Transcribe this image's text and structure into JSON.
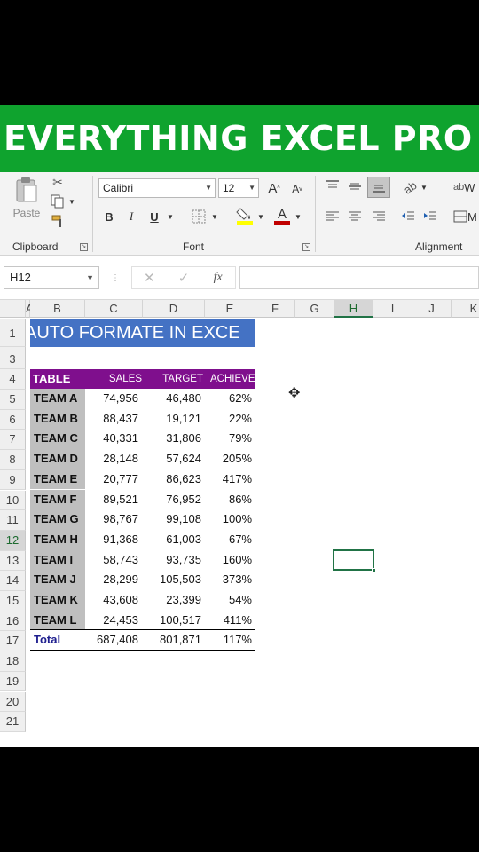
{
  "banner": {
    "text": "EVERYTHING EXCEL PRO"
  },
  "ribbon": {
    "clipboard": {
      "paste_label": "Paste",
      "group_label": "Clipboard"
    },
    "font": {
      "font_name": "Calibri",
      "font_size": "12",
      "grow_label": "A",
      "shrink_label": "A",
      "bold": "B",
      "italic": "I",
      "underline": "U",
      "font_color_label": "A",
      "group_label": "Font"
    },
    "alignment": {
      "group_label": "Alignment",
      "wrap_label": "W",
      "merge_label": "M"
    },
    "colors": {
      "highlight": "#ffff00",
      "font_color": "#c00000"
    }
  },
  "formula_bar": {
    "name_box": "H12",
    "cancel": "✕",
    "enter": "✓",
    "fx": "fx",
    "formula": ""
  },
  "columns": [
    "A",
    "B",
    "C",
    "D",
    "E",
    "F",
    "G",
    "H",
    "I",
    "J",
    "K"
  ],
  "selected_column": "H",
  "rows": [
    "1",
    "2",
    "3",
    "4",
    "5",
    "6",
    "7",
    "8",
    "9",
    "10",
    "11",
    "12",
    "13",
    "14",
    "15",
    "16",
    "17",
    "18",
    "19",
    "20",
    "21"
  ],
  "selected_row": "12",
  "sheet": {
    "title": "AUTO FORMATE IN EXCE",
    "headers": [
      "TABLE",
      "SALES",
      "TARGET",
      "ACHIEVE"
    ],
    "teams": [
      {
        "team": "TEAM A",
        "sales": "74,956",
        "target": "46,480",
        "achieve": "62%"
      },
      {
        "team": "TEAM B",
        "sales": "88,437",
        "target": "19,121",
        "achieve": "22%"
      },
      {
        "team": "TEAM C",
        "sales": "40,331",
        "target": "31,806",
        "achieve": "79%"
      },
      {
        "team": "TEAM D",
        "sales": "28,148",
        "target": "57,624",
        "achieve": "205%"
      },
      {
        "team": "TEAM E",
        "sales": "20,777",
        "target": "86,623",
        "achieve": "417%"
      },
      {
        "team": "TEAM F",
        "sales": "89,521",
        "target": "76,952",
        "achieve": "86%"
      },
      {
        "team": "TEAM G",
        "sales": "98,767",
        "target": "99,108",
        "achieve": "100%"
      },
      {
        "team": "TEAM H",
        "sales": "91,368",
        "target": "61,003",
        "achieve": "67%"
      },
      {
        "team": "TEAM I",
        "sales": "58,743",
        "target": "93,735",
        "achieve": "160%"
      },
      {
        "team": "TEAM J",
        "sales": "28,299",
        "target": "105,503",
        "achieve": "373%"
      },
      {
        "team": "TEAM K",
        "sales": "43,608",
        "target": "23,399",
        "achieve": "54%"
      },
      {
        "team": "TEAM L",
        "sales": "24,453",
        "target": "100,517",
        "achieve": "411%"
      }
    ],
    "total": {
      "label": "Total",
      "sales": "687,408",
      "target": "801,871",
      "achieve": "117%"
    },
    "colors": {
      "title_fill": "#4472c4",
      "header_fill": "#7f0f8d",
      "team_fill": "#bfbfbf",
      "total_text": "#1f1f8f",
      "selection": "#217346"
    }
  }
}
